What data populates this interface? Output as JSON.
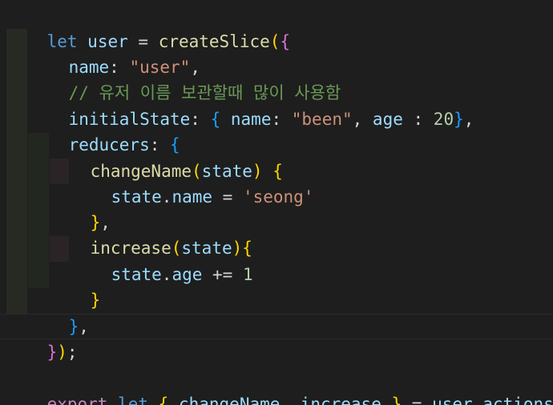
{
  "code": {
    "l1": {
      "let": "let",
      "user": "user",
      "eq": " = ",
      "fn": "createSlice",
      "p": "(",
      "b": "{"
    },
    "l2": {
      "key": "name",
      "colon": ": ",
      "val": "\"user\"",
      "comma": ","
    },
    "l3": {
      "comment": "// 유저 이름 보관할때 많이 사용함"
    },
    "l4": {
      "key": "initialState",
      "colon": ": ",
      "ob": "{",
      "name": " name",
      "c2": ": ",
      "been": "\"been\"",
      "comma": ", ",
      "age": "age",
      "c3": " : ",
      "num": "20",
      "cb": "}",
      "end": ","
    },
    "l5": {
      "key": "reducers",
      "colon": ": ",
      "ob": "{"
    },
    "l6": {
      "fn": "changeName",
      "op": "(",
      "param": "state",
      "cp": ")",
      "sp": " ",
      "ob": "{"
    },
    "l7": {
      "state": "state",
      "dot": ".",
      "prop": "name",
      "eq": " = ",
      "str": "'seong'"
    },
    "l8": {
      "cb": "}",
      "comma": ","
    },
    "l9": {
      "fn": "increase",
      "op": "(",
      "param": "state",
      "cp": ")",
      "ob": "{"
    },
    "l10": {
      "state": "state",
      "dot": ".",
      "prop": "age",
      "op": " += ",
      "num": "1"
    },
    "l11": {
      "cb": "}"
    },
    "l12": {
      "cb": "}",
      "comma": ","
    },
    "l13": {
      "cb": "}",
      "cp": ")",
      "semi": ";"
    },
    "l15": {
      "export": "export",
      "let": " let",
      "ob": " {",
      "n1": " changeName",
      "comma": ",",
      "n2": " increase",
      "cb": " }",
      "eq": " = ",
      "user": "user",
      "dot": ".",
      "actions": "actions"
    }
  },
  "colors": {
    "background": "#1e1e1e",
    "keyword": "#569cd6",
    "control_keyword": "#c586c0",
    "function": "#dcdcaa",
    "variable": "#9cdcfe",
    "string": "#ce9178",
    "number": "#b5cea8",
    "comment": "#6a9955",
    "bracket_level1": "#ffd700",
    "bracket_level2": "#da70d6",
    "bracket_level3": "#179fff"
  }
}
